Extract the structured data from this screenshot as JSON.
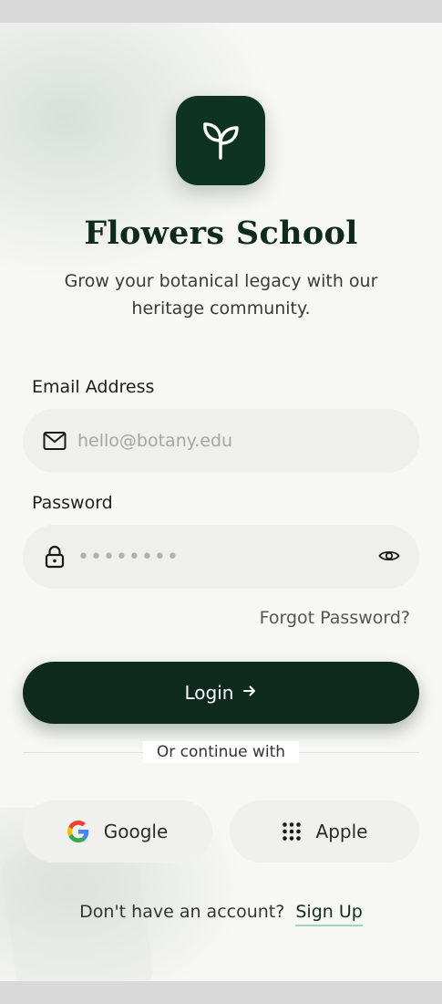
{
  "app": {
    "title": "Flowers School",
    "subtitle": "Grow your botanical legacy with our heritage community.",
    "logo_icon": "sprout-icon"
  },
  "form": {
    "email_label": "Email Address",
    "email_placeholder": "hello@botany.edu",
    "password_label": "Password",
    "password_mask": "••••••••",
    "forgot_label": "Forgot Password?",
    "login_label": "Login"
  },
  "social": {
    "divider_text": "Or continue with",
    "google_label": "Google",
    "apple_label": "Apple"
  },
  "footer": {
    "prompt": "Don't have an account?",
    "signup_label": "Sign Up"
  },
  "colors": {
    "brand": "#0e2a1d",
    "accent_underline": "#9fd4bd",
    "background": "#f7f7f5"
  }
}
